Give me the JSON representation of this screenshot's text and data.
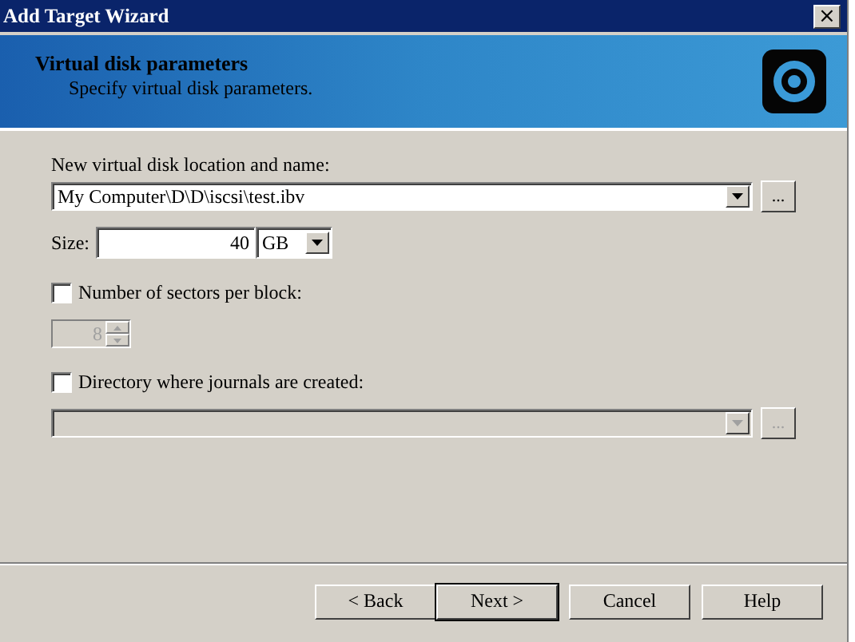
{
  "window": {
    "title": "Add Target Wizard",
    "close": "×"
  },
  "header": {
    "title": "Virtual disk parameters",
    "subtitle": "Specify virtual disk parameters."
  },
  "location": {
    "label": "New virtual disk location and name:",
    "value": "My Computer\\D\\D\\iscsi\\test.ibv",
    "browse": "..."
  },
  "size": {
    "label": "Size:",
    "value": "40",
    "unit": "GB"
  },
  "sectors": {
    "label": "Number of sectors per block:",
    "checked": false,
    "value": "8"
  },
  "journals": {
    "label": "Directory where journals are created:",
    "checked": false,
    "browse": "..."
  },
  "buttons": [
    {
      "label": "< Back",
      "default": false
    },
    {
      "label": "Next >",
      "default": true
    },
    {
      "label": "Cancel",
      "default": false
    },
    {
      "label": "Help",
      "default": false
    }
  ]
}
